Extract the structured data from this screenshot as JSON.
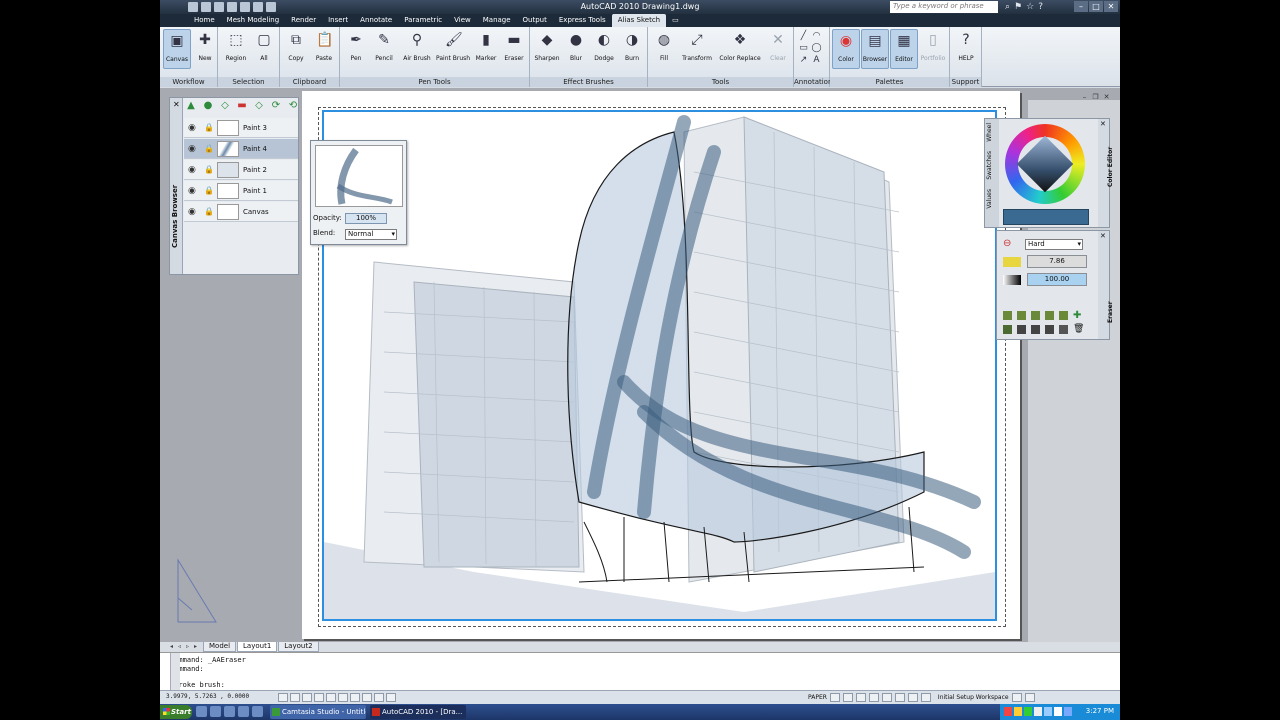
{
  "window": {
    "title": "AutoCAD 2010    Drawing1.dwg",
    "search_placeholder": "Type a keyword or phrase",
    "app_logo": "A"
  },
  "ribbon_tabs": [
    "Home",
    "Mesh Modeling",
    "Render",
    "Insert",
    "Annotate",
    "Parametric",
    "View",
    "Manage",
    "Output",
    "Express Tools",
    "Alias Sketch"
  ],
  "active_tab": "Alias Sketch",
  "ribbon": {
    "panels": {
      "workflow": "Workflow",
      "selection": "Selection",
      "clipboard": "Clipboard",
      "pen_tools": "Pen Tools",
      "effect_brushes": "Effect Brushes",
      "tools": "Tools",
      "annotation": "Annotation",
      "palettes": "Palettes",
      "support": "Support"
    },
    "tools": {
      "canvas": "Canvas",
      "new": "New",
      "region": "Region",
      "all": "All",
      "copy": "Copy",
      "paste": "Paste",
      "pen": "Pen",
      "pencil": "Pencil",
      "air_brush": "Air Brush",
      "paint_brush": "Paint Brush",
      "marker": "Marker",
      "eraser": "Eraser",
      "sharpen": "Sharpen",
      "blur": "Blur",
      "dodge": "Dodge",
      "burn": "Burn",
      "fill": "Fill",
      "transform": "Transform",
      "color_replace": "Color Replace",
      "clear": "Clear",
      "color": "Color",
      "browser": "Browser",
      "editor": "Editor",
      "portfolio": "Portfolio",
      "help": "HELP"
    }
  },
  "canvas_browser": {
    "title": "Canvas Browser",
    "layers": [
      "Paint 3",
      "Paint 4",
      "Paint 2",
      "Paint 1",
      "Canvas"
    ],
    "selected": "Paint 4"
  },
  "layer_popup": {
    "opacity_label": "Opacity:",
    "opacity_value": "100%",
    "blend_label": "Blend:",
    "blend_value": "Normal"
  },
  "color_editor": {
    "title": "Color Editor",
    "tabs": [
      "Wheel",
      "Swatches",
      "Values"
    ],
    "current_color": "#3a6a92"
  },
  "eraser_panel": {
    "title": "Eraser",
    "mode": "Hard",
    "size_value": "7.86",
    "opacity_value": "100.00"
  },
  "layout_tabs": [
    "Model",
    "Layout1",
    "Layout2"
  ],
  "active_layout": "Layout1",
  "command_line": [
    "Command:  _AAEraser",
    "Command:",
    "Stroke brush:"
  ],
  "status": {
    "coords": "3.9979, 5.7263 , 0.0000",
    "paper": "PAPER",
    "workspace": "Initial Setup Workspace"
  },
  "taskbar": {
    "start": "Start",
    "tasks": [
      "Camtasia Studio - Untitle...",
      "AutoCAD 2010 - [Dra..."
    ],
    "clock": "3:27 PM"
  }
}
